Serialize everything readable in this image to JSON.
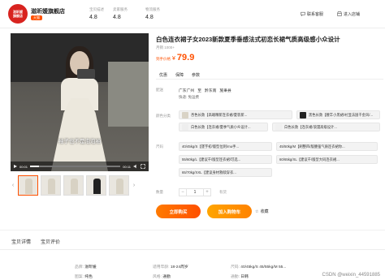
{
  "shop": {
    "logo_text": "滋昕媛\n旗舰店",
    "name": "滋昕媛旗舰店",
    "tag": "天猫"
  },
  "ratings": [
    {
      "label": "宝贝描述",
      "value": "4.8"
    },
    {
      "label": "卖家服务",
      "value": "4.8"
    },
    {
      "label": "物流服务",
      "value": "4.8"
    }
  ],
  "header_buttons": {
    "contact": "联系客服",
    "enter_shop": "进入店铺"
  },
  "video": {
    "caption": "袖子也不是泡泡袖",
    "time_current": "00:01",
    "time_total": "00:11",
    "progress": 0.1
  },
  "product": {
    "title": "白色连衣裙子女2023新款夏季垂感法式初恋长裙气质高级感小众设计",
    "sold": "月销 1000+",
    "price_label": "到手价格",
    "price_symbol": "¥",
    "price": "79.9"
  },
  "info_tabs": [
    "优惠",
    "保障",
    "参数"
  ],
  "shipping": {
    "label": "配送",
    "from": "广东广州",
    "to_label": "至",
    "to": "黔东南",
    "district": "施秉县",
    "sub": "快递: 免运费"
  },
  "color_label": "颜色分类",
  "colors": [
    "杏色长款【高端精新连衣裙/夏装新...",
    "黑色长款【腰丰小黑裙/衬显法国千金风/...",
    "白色长款【连衣裙/夏季气质小众设计...",
    "白色长款【连衣裙/浪漫高级设计..."
  ],
  "size_label": "尺码",
  "sizes": [
    "40/45kg/S【镂字初/版型位刺/mu手...",
    "45/50kg/M【刷整四/版腰强气质连衣裙你...",
    "55/60kg/L【建议千/版型连衣裙/可选...",
    "60/65kg/XL【建议千/版型大码连衣裙...",
    "65/70kg/XXL【建议身材救赎穿衣..."
  ],
  "quantity": {
    "label": "数量",
    "value": "1",
    "stock": "有货"
  },
  "actions": {
    "buy": "立即购买",
    "cart": "加入购物车",
    "favorite": "收藏"
  },
  "detail_tabs": [
    "宝贝详情",
    "宝贝评价"
  ],
  "specs": [
    {
      "k": "品牌:",
      "v": "滋昕媛"
    },
    {
      "k": "适用年龄:",
      "v": "18-24周岁"
    },
    {
      "k": "尺码:",
      "v": "40/45kg/S 45/55kg/M 55..."
    },
    {
      "k": "图案:",
      "v": "纯色"
    },
    {
      "k": "风格:",
      "v": "通勤"
    },
    {
      "k": "通勤:",
      "v": "日韩"
    }
  ],
  "watermark": "CSDN @weixin_44591885"
}
